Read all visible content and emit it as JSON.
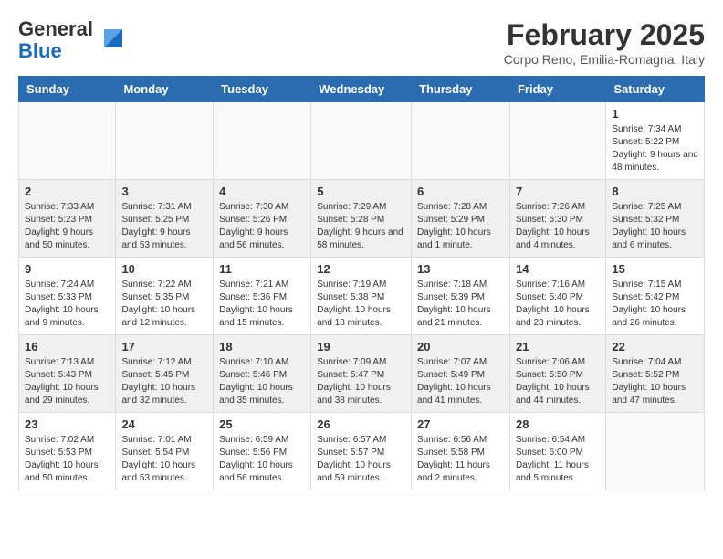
{
  "header": {
    "logo_general": "General",
    "logo_blue": "Blue",
    "month_title": "February 2025",
    "location": "Corpo Reno, Emilia-Romagna, Italy"
  },
  "columns": [
    "Sunday",
    "Monday",
    "Tuesday",
    "Wednesday",
    "Thursday",
    "Friday",
    "Saturday"
  ],
  "weeks": [
    {
      "shaded": false,
      "days": [
        {
          "num": "",
          "info": ""
        },
        {
          "num": "",
          "info": ""
        },
        {
          "num": "",
          "info": ""
        },
        {
          "num": "",
          "info": ""
        },
        {
          "num": "",
          "info": ""
        },
        {
          "num": "",
          "info": ""
        },
        {
          "num": "1",
          "info": "Sunrise: 7:34 AM\nSunset: 5:22 PM\nDaylight: 9 hours and 48 minutes."
        }
      ]
    },
    {
      "shaded": true,
      "days": [
        {
          "num": "2",
          "info": "Sunrise: 7:33 AM\nSunset: 5:23 PM\nDaylight: 9 hours and 50 minutes."
        },
        {
          "num": "3",
          "info": "Sunrise: 7:31 AM\nSunset: 5:25 PM\nDaylight: 9 hours and 53 minutes."
        },
        {
          "num": "4",
          "info": "Sunrise: 7:30 AM\nSunset: 5:26 PM\nDaylight: 9 hours and 56 minutes."
        },
        {
          "num": "5",
          "info": "Sunrise: 7:29 AM\nSunset: 5:28 PM\nDaylight: 9 hours and 58 minutes."
        },
        {
          "num": "6",
          "info": "Sunrise: 7:28 AM\nSunset: 5:29 PM\nDaylight: 10 hours and 1 minute."
        },
        {
          "num": "7",
          "info": "Sunrise: 7:26 AM\nSunset: 5:30 PM\nDaylight: 10 hours and 4 minutes."
        },
        {
          "num": "8",
          "info": "Sunrise: 7:25 AM\nSunset: 5:32 PM\nDaylight: 10 hours and 6 minutes."
        }
      ]
    },
    {
      "shaded": false,
      "days": [
        {
          "num": "9",
          "info": "Sunrise: 7:24 AM\nSunset: 5:33 PM\nDaylight: 10 hours and 9 minutes."
        },
        {
          "num": "10",
          "info": "Sunrise: 7:22 AM\nSunset: 5:35 PM\nDaylight: 10 hours and 12 minutes."
        },
        {
          "num": "11",
          "info": "Sunrise: 7:21 AM\nSunset: 5:36 PM\nDaylight: 10 hours and 15 minutes."
        },
        {
          "num": "12",
          "info": "Sunrise: 7:19 AM\nSunset: 5:38 PM\nDaylight: 10 hours and 18 minutes."
        },
        {
          "num": "13",
          "info": "Sunrise: 7:18 AM\nSunset: 5:39 PM\nDaylight: 10 hours and 21 minutes."
        },
        {
          "num": "14",
          "info": "Sunrise: 7:16 AM\nSunset: 5:40 PM\nDaylight: 10 hours and 23 minutes."
        },
        {
          "num": "15",
          "info": "Sunrise: 7:15 AM\nSunset: 5:42 PM\nDaylight: 10 hours and 26 minutes."
        }
      ]
    },
    {
      "shaded": true,
      "days": [
        {
          "num": "16",
          "info": "Sunrise: 7:13 AM\nSunset: 5:43 PM\nDaylight: 10 hours and 29 minutes."
        },
        {
          "num": "17",
          "info": "Sunrise: 7:12 AM\nSunset: 5:45 PM\nDaylight: 10 hours and 32 minutes."
        },
        {
          "num": "18",
          "info": "Sunrise: 7:10 AM\nSunset: 5:46 PM\nDaylight: 10 hours and 35 minutes."
        },
        {
          "num": "19",
          "info": "Sunrise: 7:09 AM\nSunset: 5:47 PM\nDaylight: 10 hours and 38 minutes."
        },
        {
          "num": "20",
          "info": "Sunrise: 7:07 AM\nSunset: 5:49 PM\nDaylight: 10 hours and 41 minutes."
        },
        {
          "num": "21",
          "info": "Sunrise: 7:06 AM\nSunset: 5:50 PM\nDaylight: 10 hours and 44 minutes."
        },
        {
          "num": "22",
          "info": "Sunrise: 7:04 AM\nSunset: 5:52 PM\nDaylight: 10 hours and 47 minutes."
        }
      ]
    },
    {
      "shaded": false,
      "days": [
        {
          "num": "23",
          "info": "Sunrise: 7:02 AM\nSunset: 5:53 PM\nDaylight: 10 hours and 50 minutes."
        },
        {
          "num": "24",
          "info": "Sunrise: 7:01 AM\nSunset: 5:54 PM\nDaylight: 10 hours and 53 minutes."
        },
        {
          "num": "25",
          "info": "Sunrise: 6:59 AM\nSunset: 5:56 PM\nDaylight: 10 hours and 56 minutes."
        },
        {
          "num": "26",
          "info": "Sunrise: 6:57 AM\nSunset: 5:57 PM\nDaylight: 10 hours and 59 minutes."
        },
        {
          "num": "27",
          "info": "Sunrise: 6:56 AM\nSunset: 5:58 PM\nDaylight: 11 hours and 2 minutes."
        },
        {
          "num": "28",
          "info": "Sunrise: 6:54 AM\nSunset: 6:00 PM\nDaylight: 11 hours and 5 minutes."
        },
        {
          "num": "",
          "info": ""
        }
      ]
    }
  ]
}
